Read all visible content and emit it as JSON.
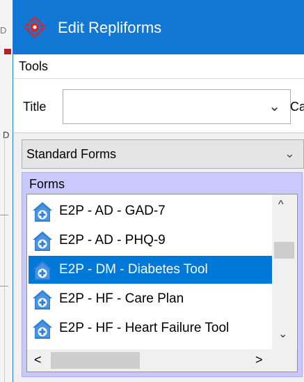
{
  "background": {
    "edge_glyph_top": "D",
    "edge_glyph_mid": "D"
  },
  "window": {
    "title": "Edit Repliforms",
    "icon": "repliforms-crosshair-icon",
    "titlebar_color": "#1078d4"
  },
  "menu": {
    "tools": "Tools"
  },
  "title_field": {
    "label": "Title",
    "value": "",
    "next_label": "Ca"
  },
  "category": {
    "selected": "Standard Forms"
  },
  "forms": {
    "legend": "Forms",
    "group_color": "#c9c9ff",
    "selection_color": "#0078d7",
    "item_icon": "house-plus-icon",
    "items": [
      {
        "label": "E2P - AD - GAD-7"
      },
      {
        "label": "E2P - AD - PHQ-9"
      },
      {
        "label": "E2P - DM - Diabetes Tool"
      },
      {
        "label": "E2P - HF - Care Plan"
      },
      {
        "label": "E2P - HF - Heart Failure Tool"
      }
    ],
    "selected_index": 2
  },
  "scrollbars": {
    "up": "^",
    "down": "⌄",
    "left": "<",
    "right": ">"
  }
}
